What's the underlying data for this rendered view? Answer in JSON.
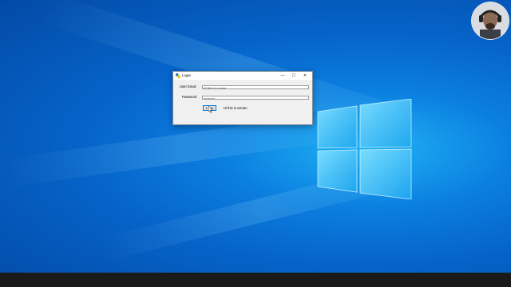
{
  "window": {
    "title": "Login",
    "minimize_glyph": "—",
    "maximize_glyph": "☐",
    "close_glyph": "✕"
  },
  "form": {
    "email_label": "User Email",
    "email_value": "Hi this is usman",
    "password_label": "Password",
    "password_value": "••••••••••",
    "login_button_label": "Login",
    "result_text": "Hi this is usman"
  },
  "icons": {
    "app_icon": "python-app-icon",
    "cursor": "mouse-pointer-icon",
    "desktop_logo": "windows-logo-icon",
    "webcam": "webcam-overlay"
  },
  "colors": {
    "desktop_blue": "#0b7fe0",
    "taskbar": "#1a1a1a",
    "focus_border": "#0078d7"
  }
}
